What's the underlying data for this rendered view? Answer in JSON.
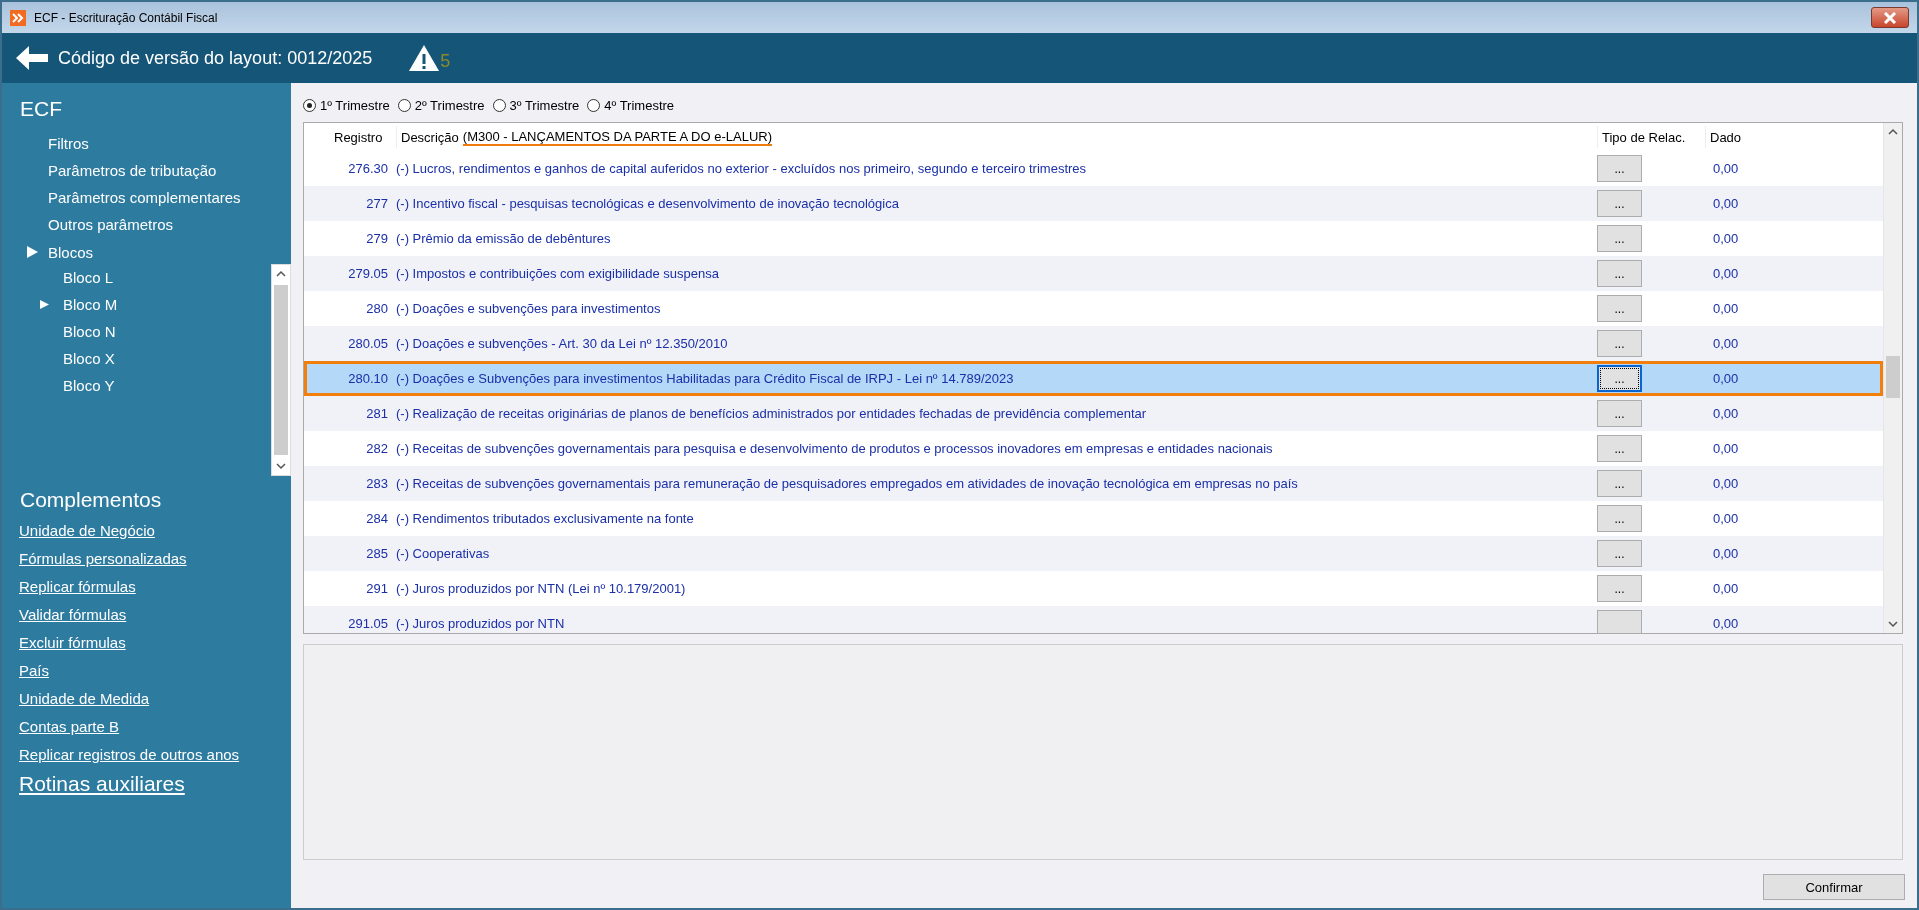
{
  "window": {
    "title": "ECF - Escrituração Contábil Fiscal"
  },
  "header": {
    "title": "Código de versão do layout: 0012/2025",
    "warning_count": "5"
  },
  "sidebar": {
    "title": "ECF",
    "items": [
      {
        "label": "Filtros"
      },
      {
        "label": "Parâmetros de tributação"
      },
      {
        "label": "Parâmetros complementares"
      },
      {
        "label": "Outros parâmetros"
      },
      {
        "label": "Blocos",
        "expanded": true,
        "children": [
          {
            "label": "Bloco L",
            "current": false
          },
          {
            "label": "Bloco M",
            "current": true
          },
          {
            "label": "Bloco N",
            "current": false
          },
          {
            "label": "Bloco X",
            "current": false
          },
          {
            "label": "Bloco Y",
            "current": false
          }
        ]
      }
    ],
    "complementos_title": "Complementos",
    "links": [
      "Unidade de Negócio",
      "Fórmulas personalizadas",
      "Replicar fórmulas",
      "Validar fórmulas",
      "Excluir fórmulas",
      "País",
      "Unidade de Medida",
      "Contas parte B",
      "Replicar registros de outros anos"
    ],
    "footer_link": "Rotinas auxiliares"
  },
  "trimesters": [
    {
      "label": "1º Trimestre",
      "selected": true
    },
    {
      "label": "2º Trimestre",
      "selected": false
    },
    {
      "label": "3º Trimestre",
      "selected": false
    },
    {
      "label": "4º Trimestre",
      "selected": false
    }
  ],
  "table": {
    "columns": [
      "Registro",
      "Descrição",
      "Tipo de Relac.",
      "Dado"
    ],
    "title": "(M300 - LANÇAMENTOS DA PARTE A DO e-LALUR)",
    "rows": [
      {
        "registro": "276.30",
        "descricao": "(-) Lucros, rendimentos e ganhos de capital auferidos no exterior - excluídos nos primeiro, segundo e terceiro trimestres",
        "button": "...",
        "dado": "0,00",
        "selected": false
      },
      {
        "registro": "277",
        "descricao": "(-) Incentivo fiscal - pesquisas tecnológicas e desenvolvimento de inovação tecnológica",
        "button": "...",
        "dado": "0,00",
        "selected": false
      },
      {
        "registro": "279",
        "descricao": "(-) Prêmio da emissão de debêntures",
        "button": "...",
        "dado": "0,00",
        "selected": false
      },
      {
        "registro": "279.05",
        "descricao": "(-) Impostos e contribuições com exigibilidade suspensa",
        "button": "...",
        "dado": "0,00",
        "selected": false
      },
      {
        "registro": "280",
        "descricao": "(-) Doações e subvenções para investimentos",
        "button": "...",
        "dado": "0,00",
        "selected": false
      },
      {
        "registro": "280.05",
        "descricao": "(-) Doações e subvenções - Art. 30 da Lei nº 12.350/2010",
        "button": "...",
        "dado": "0,00",
        "selected": false
      },
      {
        "registro": "280.10",
        "descricao": "(-) Doações e Subvenções para investimentos Habilitadas para Crédito Fiscal de IRPJ - Lei nº 14.789/2023",
        "button": "...",
        "dado": "0,00",
        "selected": true
      },
      {
        "registro": "281",
        "descricao": "(-) Realização de receitas originárias de planos de benefícios administrados por entidades fechadas de previdência complementar",
        "button": "...",
        "dado": "0,00",
        "selected": false
      },
      {
        "registro": "282",
        "descricao": "(-) Receitas de subvenções governamentais para pesquisa e desenvolvimento de produtos e processos inovadores em empresas e entidades nacionais",
        "button": "...",
        "dado": "0,00",
        "selected": false
      },
      {
        "registro": "283",
        "descricao": "(-) Receitas de subvenções governamentais para remuneração de pesquisadores empregados em atividades de inovação tecnológica em empresas no país",
        "button": "...",
        "dado": "0,00",
        "selected": false
      },
      {
        "registro": "284",
        "descricao": "(-) Rendimentos tributados exclusivamente na fonte",
        "button": "...",
        "dado": "0,00",
        "selected": false
      },
      {
        "registro": "285",
        "descricao": "(-) Cooperativas",
        "button": "...",
        "dado": "0,00",
        "selected": false
      },
      {
        "registro": "291",
        "descricao": "(-) Juros produzidos por NTN (Lei nº 10.179/2001)",
        "button": "...",
        "dado": "0,00",
        "selected": false
      },
      {
        "registro": "291.05",
        "descricao": "(-) Juros produzidos por NTN",
        "dado": "0,00",
        "selected": false
      }
    ]
  },
  "confirm_button": "Confirmar"
}
